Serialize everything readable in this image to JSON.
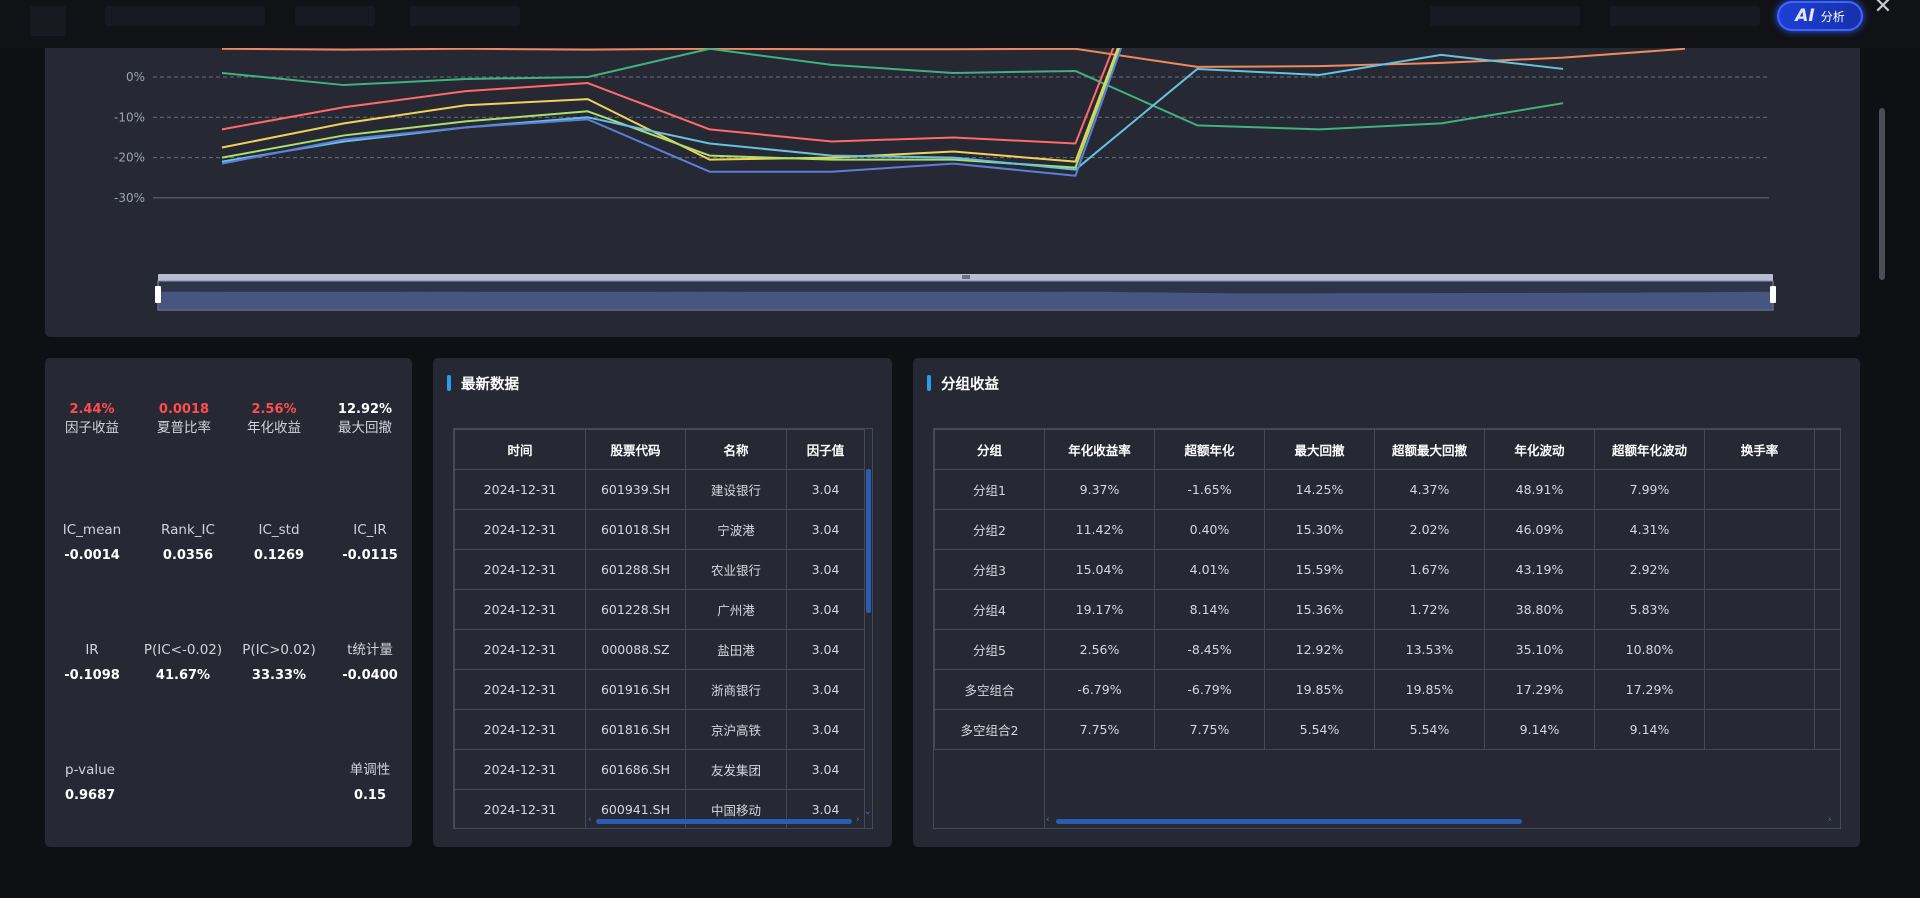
{
  "header": {
    "ai_logo": "AI",
    "ai_label": "分析",
    "close_glyph": "✕"
  },
  "chart": {
    "y_ticks": [
      "0%",
      "-10%",
      "-20%",
      "-30%"
    ]
  },
  "chart_data": {
    "type": "line",
    "ylabel": "",
    "xlabel": "",
    "y_axis_format": "percent",
    "grid": true,
    "series": [
      {
        "color": "#f08a5d",
        "values": [
          7.0,
          6.8,
          7.0,
          6.8,
          7.0,
          6.9,
          6.9,
          7.0,
          2.5,
          2.7,
          3.5,
          4.8,
          7.0
        ]
      },
      {
        "color": "#3fb27f",
        "values": [
          1.0,
          -2.0,
          -0.5,
          0.0,
          7.0,
          3.0,
          1.0,
          1.5,
          -12.0,
          -13.0,
          -11.5,
          -6.5
        ]
      },
      {
        "color": "#ff6b6b",
        "values": [
          -13.0,
          -7.5,
          -3.5,
          -1.5,
          -13.0,
          -16.0,
          -15.0,
          -16.5,
          60.0
        ]
      },
      {
        "color": "#f2d15a",
        "values": [
          -17.5,
          -11.5,
          -7.0,
          -5.5,
          -20.5,
          -20.0,
          -18.5,
          -21.0,
          60.0
        ]
      },
      {
        "color": "#a8e06e",
        "values": [
          -20.0,
          -14.5,
          -11.0,
          -8.5,
          -19.5,
          -20.5,
          -20.5,
          -22.5,
          60.0
        ]
      },
      {
        "color": "#66c2e0",
        "values": [
          -21.0,
          -16.0,
          -12.5,
          -10.0,
          -16.5,
          -19.5,
          -20.0,
          -23.0,
          2.0,
          0.5,
          5.5,
          2.0
        ]
      },
      {
        "color": "#5b7fd6",
        "values": [
          -21.5,
          -15.5,
          -12.5,
          -10.5,
          -23.5,
          -23.5,
          -21.5,
          -24.5,
          60.0
        ]
      }
    ]
  },
  "metrics": {
    "factor_return": {
      "label": "因子收益",
      "value": "2.44%"
    },
    "sharpe": {
      "label": "夏普比率",
      "value": "0.0018"
    },
    "annual_return": {
      "label": "年化收益",
      "value": "2.56%"
    },
    "max_drawdown": {
      "label": "最大回撤",
      "value": "12.92%"
    },
    "ic_mean": {
      "label": "IC_mean",
      "value": "-0.0014"
    },
    "rank_ic": {
      "label": "Rank_IC",
      "value": "0.0356"
    },
    "ic_std": {
      "label": "IC_std",
      "value": "0.1269"
    },
    "ic_ir": {
      "label": "IC_IR",
      "value": "-0.0115"
    },
    "ir": {
      "label": "IR",
      "value": "-0.1098"
    },
    "p_ic_lt": {
      "label": "P(IC<-0.02)",
      "value": "41.67%"
    },
    "p_ic_gt": {
      "label": "P(IC>0.02)",
      "value": "33.33%"
    },
    "t_stat": {
      "label": "t统计量",
      "value": "-0.0400"
    },
    "p_value": {
      "label": "p-value",
      "value": "0.9687"
    },
    "monotonic": {
      "label": "单调性",
      "value": "0.15"
    }
  },
  "latest": {
    "title": "最新数据",
    "columns": [
      "时间",
      "股票代码",
      "名称",
      "因子值"
    ],
    "rows": [
      [
        "2024-12-31",
        "601939.SH",
        "建设银行",
        "3.04"
      ],
      [
        "2024-12-31",
        "601018.SH",
        "宁波港",
        "3.04"
      ],
      [
        "2024-12-31",
        "601288.SH",
        "农业银行",
        "3.04"
      ],
      [
        "2024-12-31",
        "601228.SH",
        "广州港",
        "3.04"
      ],
      [
        "2024-12-31",
        "000088.SZ",
        "盐田港",
        "3.04"
      ],
      [
        "2024-12-31",
        "601916.SH",
        "浙商银行",
        "3.04"
      ],
      [
        "2024-12-31",
        "601816.SH",
        "京沪高铁",
        "3.04"
      ],
      [
        "2024-12-31",
        "601686.SH",
        "友发集团",
        "3.04"
      ],
      [
        "2024-12-31",
        "600941.SH",
        "中国移动",
        "3.04"
      ]
    ]
  },
  "group": {
    "title": "分组收益",
    "columns": [
      "分组",
      "年化收益率",
      "超额年化",
      "最大回撤",
      "超额最大回撤",
      "年化波动",
      "超额年化波动",
      "换手率"
    ],
    "rows": [
      [
        "分组1",
        "9.37%",
        "-1.65%",
        "14.25%",
        "4.37%",
        "48.91%",
        "7.99%",
        ""
      ],
      [
        "分组2",
        "11.42%",
        "0.40%",
        "15.30%",
        "2.02%",
        "46.09%",
        "4.31%",
        ""
      ],
      [
        "分组3",
        "15.04%",
        "4.01%",
        "15.59%",
        "1.67%",
        "43.19%",
        "2.92%",
        ""
      ],
      [
        "分组4",
        "19.17%",
        "8.14%",
        "15.36%",
        "1.72%",
        "38.80%",
        "5.83%",
        ""
      ],
      [
        "分组5",
        "2.56%",
        "-8.45%",
        "12.92%",
        "13.53%",
        "35.10%",
        "10.80%",
        ""
      ],
      [
        "多空组合",
        "-6.79%",
        "-6.79%",
        "19.85%",
        "19.85%",
        "17.29%",
        "17.29%",
        ""
      ],
      [
        "多空组合2",
        "7.75%",
        "7.75%",
        "5.54%",
        "5.54%",
        "9.14%",
        "9.14%",
        ""
      ]
    ]
  }
}
